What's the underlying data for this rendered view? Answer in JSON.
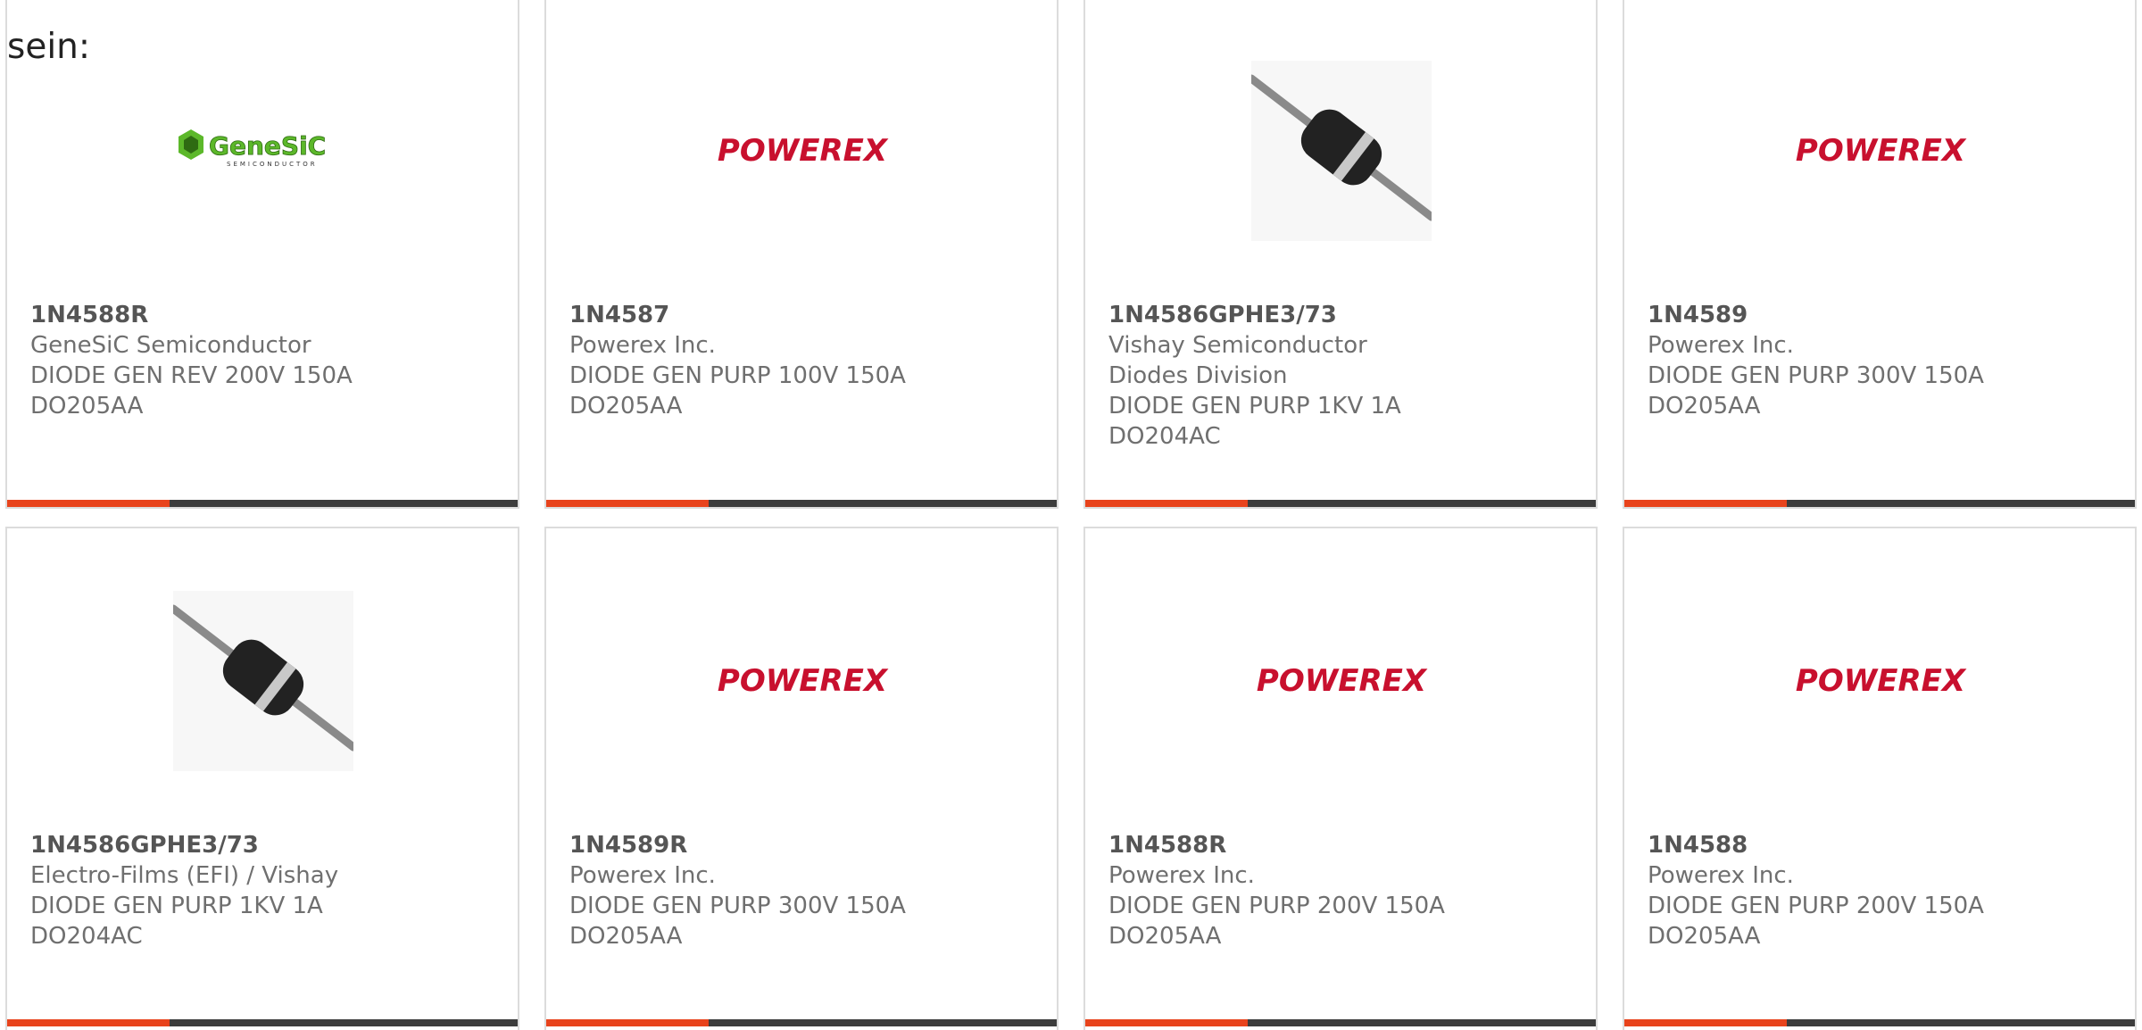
{
  "intro_text": "sein:",
  "colors": {
    "accent": "#e8431c",
    "bar": "#3c3c3c",
    "powerex_red": "#c8102e",
    "genesic_green": "#5cb82a"
  },
  "products": [
    {
      "part": "1N4588R",
      "manufacturer": "GeneSiC Semiconductor",
      "description": "DIODE GEN REV 200V 150A",
      "package": "DO205AA",
      "image": "genesic-logo"
    },
    {
      "part": "1N4587",
      "manufacturer": "Powerex Inc.",
      "description": "DIODE GEN PURP 100V 150A",
      "package": "DO205AA",
      "image": "powerex-logo"
    },
    {
      "part": "1N4586GPHE3/73",
      "manufacturer": "Vishay Semiconductor Diodes Division",
      "description": "DIODE GEN PURP 1KV 1A",
      "package": "DO204AC",
      "image": "axial-diode-photo"
    },
    {
      "part": "1N4589",
      "manufacturer": "Powerex Inc.",
      "description": "DIODE GEN PURP 300V 150A",
      "package": "DO205AA",
      "image": "powerex-logo"
    },
    {
      "part": "1N4586GPHE3/73",
      "manufacturer": "Electro-Films (EFI) / Vishay",
      "description": "DIODE GEN PURP 1KV 1A",
      "package": "DO204AC",
      "image": "axial-diode-photo"
    },
    {
      "part": "1N4589R",
      "manufacturer": "Powerex Inc.",
      "description": "DIODE GEN PURP 300V 150A",
      "package": "DO205AA",
      "image": "powerex-logo"
    },
    {
      "part": "1N4588R",
      "manufacturer": "Powerex Inc.",
      "description": "DIODE GEN PURP 200V 150A",
      "package": "DO205AA",
      "image": "powerex-logo"
    },
    {
      "part": "1N4588",
      "manufacturer": "Powerex Inc.",
      "description": "DIODE GEN PURP 200V 150A",
      "package": "DO205AA",
      "image": "powerex-logo"
    }
  ],
  "logo_text": {
    "genesic": "GeneSiC",
    "genesic_sub": "SEMICONDUCTOR",
    "powerex": "POWEREX"
  }
}
